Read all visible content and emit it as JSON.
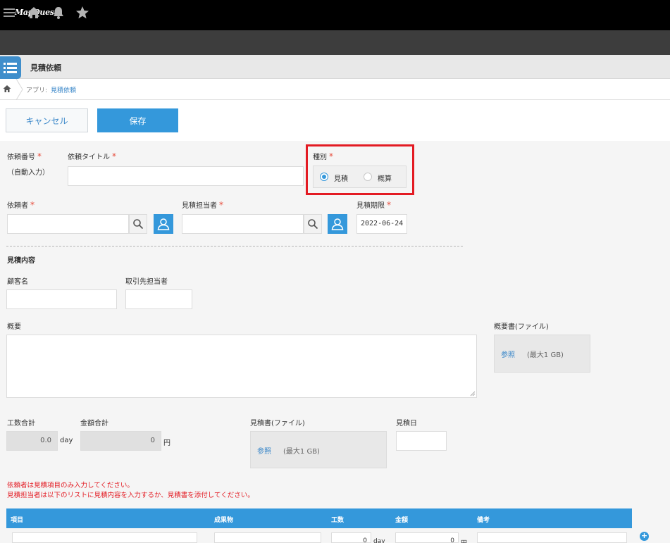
{
  "header": {
    "brand": "MapQuest"
  },
  "app": {
    "title": "見積依頼"
  },
  "breadcrumb": {
    "prefix": "アプリ:",
    "app": "見積依頼"
  },
  "toolbar": {
    "cancel_label": "キャンセル",
    "save_label": "保存"
  },
  "form": {
    "request_number": {
      "label": "依頼番号",
      "required_mark": "*",
      "auto_text": "（自動入力）"
    },
    "request_title": {
      "label": "依頼タイトル",
      "required_mark": "*",
      "value": ""
    },
    "type": {
      "label": "種別",
      "required_mark": "*",
      "options": [
        {
          "label": "見積",
          "selected": true
        },
        {
          "label": "概算",
          "selected": false
        }
      ]
    },
    "requester": {
      "label": "依頼者",
      "required_mark": "*",
      "value": ""
    },
    "estimator": {
      "label": "見積担当者",
      "required_mark": "*",
      "value": ""
    },
    "deadline": {
      "label": "見積期限",
      "required_mark": "*",
      "value": "2022-06-24"
    },
    "section_title": "見積内容",
    "customer": {
      "label": "顧客名",
      "value": ""
    },
    "client_contact": {
      "label": "取引先担当者",
      "value": ""
    },
    "summary": {
      "label": "概要",
      "value": ""
    },
    "summary_file": {
      "label": "概要書(ファイル)",
      "browse": "参照",
      "limit": "(最大1 GB)"
    },
    "total_hours": {
      "label": "工数合計",
      "value": "0.0",
      "unit": "day"
    },
    "total_amount": {
      "label": "金額合計",
      "value": "0",
      "unit": "円"
    },
    "estimate_file": {
      "label": "見積書(ファイル)",
      "browse": "参照",
      "limit": "(最大1 GB)"
    },
    "estimate_date": {
      "label": "見積日",
      "value": ""
    },
    "notes": [
      "依頼者は見積項目のみ入力してください。",
      "見積担当者は以下のリストに見積内容を入力するか、見積書を添付してください。"
    ]
  },
  "table": {
    "headers": [
      "項目",
      "成果物",
      "工数",
      "金額",
      "備考"
    ],
    "row": {
      "hours": "0",
      "hours_unit": "day",
      "amount": "0",
      "amount_unit": "円"
    }
  },
  "colors": {
    "accent": "#3498db",
    "highlight": "#e31b23",
    "required": "#e74c3c"
  },
  "icons": [
    "menu-icon",
    "home-icon",
    "bell-icon",
    "star-icon",
    "app-list-icon",
    "search-icon",
    "user-icon",
    "plus-icon"
  ]
}
